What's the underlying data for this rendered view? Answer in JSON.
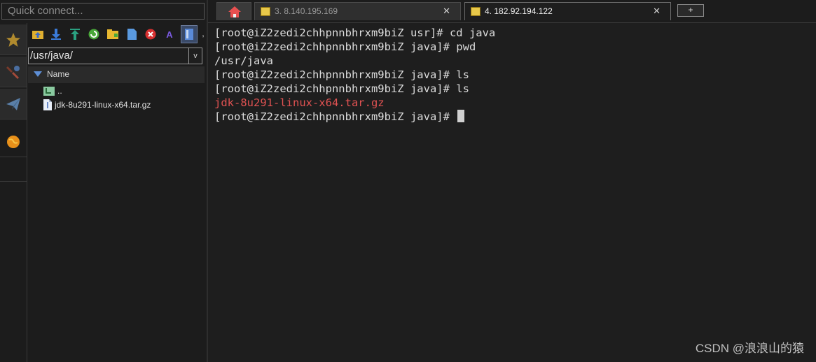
{
  "quick_connect": {
    "placeholder": "Quick connect..."
  },
  "sftp": {
    "path": "/usr/java/",
    "column_header": "Name",
    "files": [
      {
        "name": ".."
      },
      {
        "name": "jdk-8u291-linux-x64.tar.gz"
      }
    ]
  },
  "tabs": [
    {
      "label": "3. 8.140.195.169",
      "active": false
    },
    {
      "label": "4. 182.92.194.122",
      "active": true
    }
  ],
  "new_tab_label": "+",
  "close_glyph": "✕",
  "terminal": {
    "lines": [
      {
        "text": "[root@iZ2zedi2chhpnnbhrxm9biZ usr]# cd java",
        "color": "#dcdcdc"
      },
      {
        "text": "[root@iZ2zedi2chhpnnbhrxm9biZ java]# pwd",
        "color": "#dcdcdc"
      },
      {
        "text": "/usr/java",
        "color": "#dcdcdc"
      },
      {
        "text": "[root@iZ2zedi2chhpnnbhrxm9biZ java]# ls",
        "color": "#dcdcdc"
      },
      {
        "text": "[root@iZ2zedi2chhpnnbhrxm9biZ java]# ls",
        "color": "#dcdcdc"
      },
      {
        "text": "jdk-8u291-linux-x64.tar.gz",
        "color": "#e05252"
      },
      {
        "text": "[root@iZ2zedi2chhpnnbhrxm9biZ java]# ",
        "color": "#dcdcdc"
      }
    ]
  },
  "watermark": "CSDN @浪浪山的猿",
  "colors": {
    "archive_file": "#e05252",
    "accent": "#5e8fd6"
  }
}
